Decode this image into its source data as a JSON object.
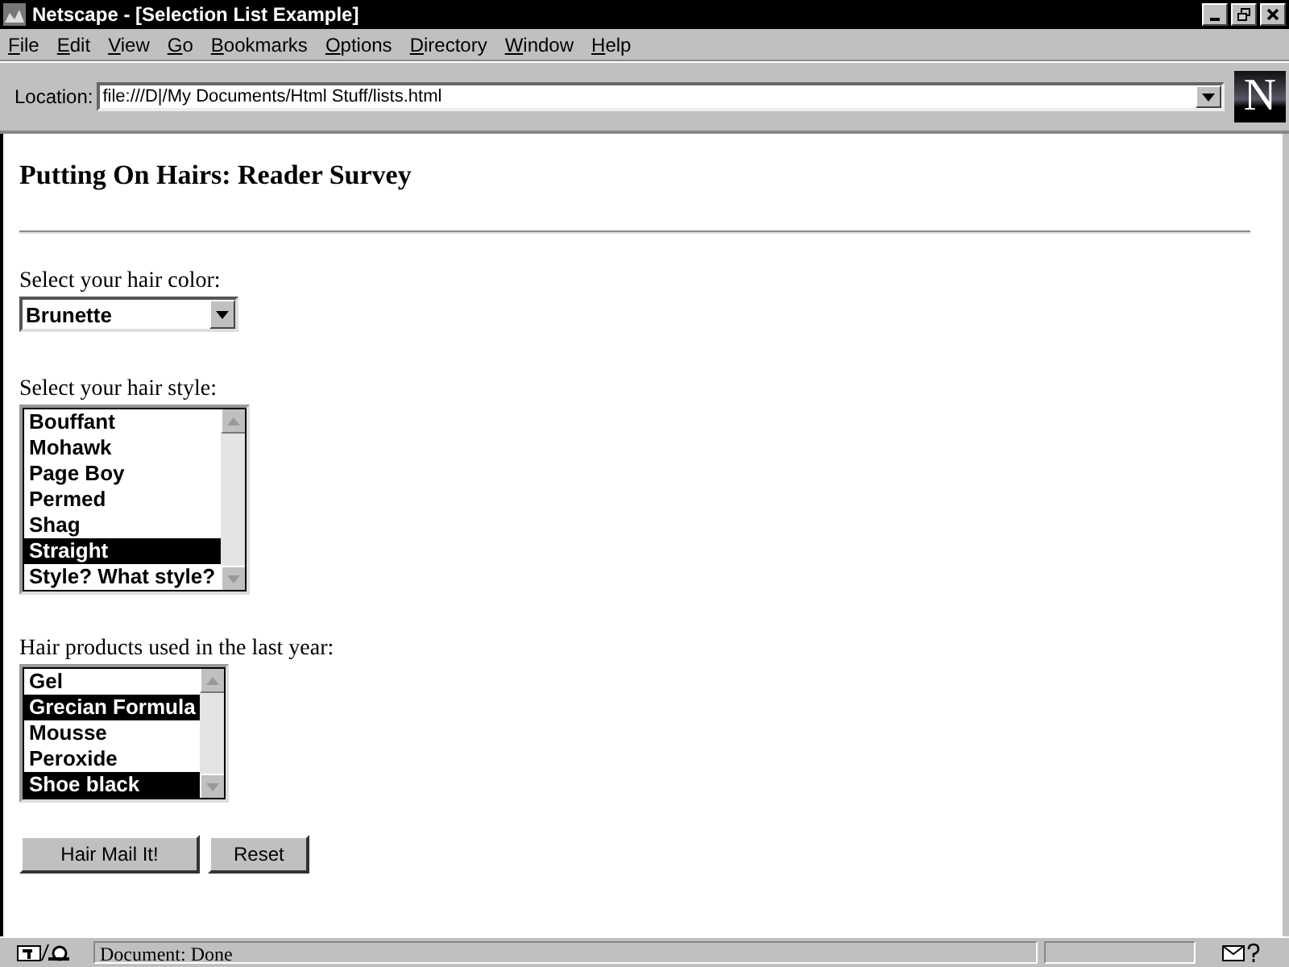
{
  "window": {
    "title": "Netscape - [Selection List Example]"
  },
  "menu": [
    "File",
    "Edit",
    "View",
    "Go",
    "Bookmarks",
    "Options",
    "Directory",
    "Window",
    "Help"
  ],
  "location": {
    "label": "Location:",
    "value": "file:///D|/My Documents/Html Stuff/lists.html"
  },
  "logo": "N",
  "page": {
    "heading": "Putting On Hairs: Reader Survey",
    "color": {
      "label": "Select your hair color:",
      "value": "Brunette"
    },
    "style": {
      "label": "Select your hair style:",
      "options": [
        {
          "text": "Bouffant",
          "selected": false
        },
        {
          "text": "Mohawk",
          "selected": false
        },
        {
          "text": "Page Boy",
          "selected": false
        },
        {
          "text": "Permed",
          "selected": false
        },
        {
          "text": "Shag",
          "selected": false
        },
        {
          "text": "Straight",
          "selected": true
        },
        {
          "text": "Style? What style?",
          "selected": false
        }
      ]
    },
    "products": {
      "label": "Hair products used in the last year:",
      "options": [
        {
          "text": "Gel",
          "selected": false
        },
        {
          "text": "Grecian Formula",
          "selected": true
        },
        {
          "text": "Mousse",
          "selected": false
        },
        {
          "text": "Peroxide",
          "selected": false
        },
        {
          "text": "Shoe black",
          "selected": true
        }
      ]
    },
    "buttons": [
      "Hair Mail It!",
      "Reset"
    ]
  },
  "status_bar": {
    "text": "Document: Done"
  }
}
